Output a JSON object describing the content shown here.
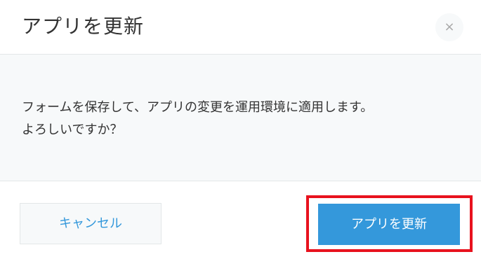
{
  "dialog": {
    "title": "アプリを更新",
    "close_label": "×",
    "message_lines": [
      "フォームを保存して、アプリの変更を運用環境に適用します。",
      "よろしいですか？"
    ],
    "cancel_label": "キャンセル",
    "confirm_label": "アプリを更新"
  },
  "colors": {
    "primary": "#3498db",
    "highlight": "#e8121e",
    "body_background": "#f7f9fa",
    "border": "#e3e7e8"
  }
}
